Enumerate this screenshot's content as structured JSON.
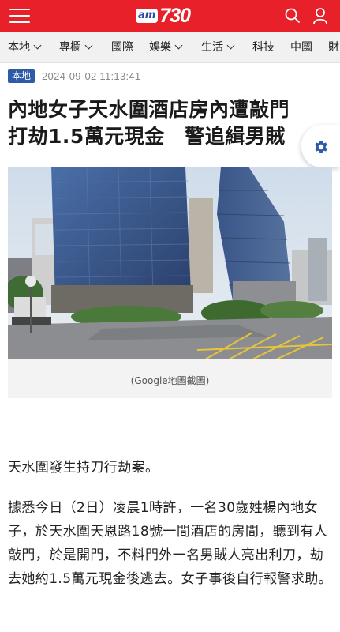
{
  "header": {
    "logo_prefix": "am",
    "logo_number": "730",
    "colors": {
      "brand_red": "#e8202a",
      "tag_blue": "#2e5aa7",
      "gear_blue": "#2e5aa7"
    },
    "icons": [
      "menu-icon",
      "search-icon",
      "user-icon",
      "gear-icon"
    ]
  },
  "nav": {
    "items": [
      {
        "label": "本地",
        "has_dropdown": true
      },
      {
        "label": "專欄",
        "has_dropdown": true
      },
      {
        "label": "國際",
        "has_dropdown": false
      },
      {
        "label": "娛樂",
        "has_dropdown": true
      },
      {
        "label": "生活",
        "has_dropdown": true
      },
      {
        "label": "科技",
        "has_dropdown": false
      },
      {
        "label": "中國",
        "has_dropdown": false
      },
      {
        "label": "財",
        "has_dropdown": false
      }
    ]
  },
  "article": {
    "category": "本地",
    "datetime": "2024-09-02 11:13:41",
    "title_line1": "內地女子天水圍酒店房內遭敲門",
    "title_line2": "打劫1.5萬元現金　警追緝男賊",
    "image_caption": "(Google地圖截圖)",
    "paragraphs": [
      "天水圍發生持刀行劫案。",
      "據悉今日（2日）凌晨1時許，一名30歲姓楊內地女子，於天水圍天恩路18號一間酒店的房間，聽到有人敲門，於是開門，不料門外一名男賊人亮出利刀，劫去她約1.5萬元現金後逃去。女子事後自行報警求助。"
    ]
  }
}
